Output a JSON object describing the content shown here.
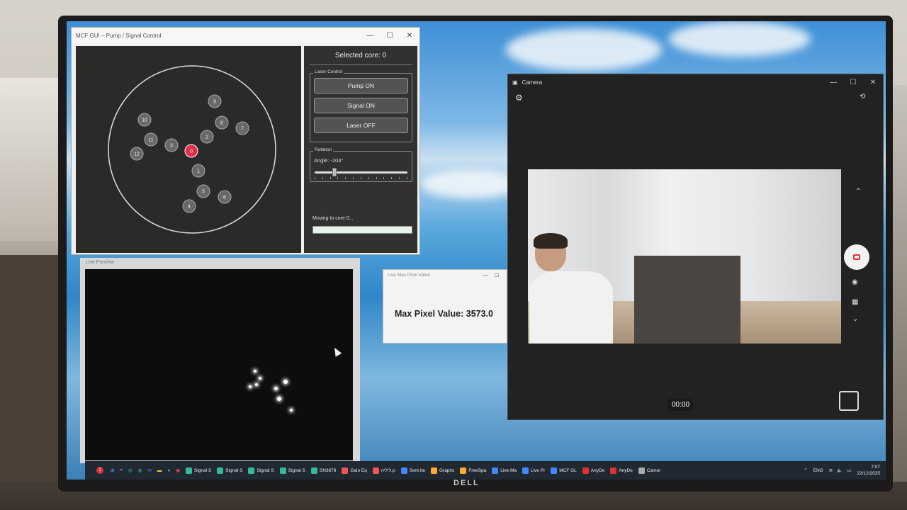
{
  "mcf_window": {
    "title": "MCF GUI – Pump / Signal Control",
    "selected_core": "Selected core: 0",
    "laser_group": "Laser Control",
    "pump_on": "Pump ON",
    "signal_on": "Signal ON",
    "laser_off": "Laser OFF",
    "rotation_group": "Rotation",
    "angle": "Angle: -104°",
    "rotation_angle_value": -104,
    "moving": "Moving to core 0...",
    "cores": [
      "0",
      "1",
      "2",
      "3",
      "4",
      "5",
      "6",
      "7",
      "8",
      "9",
      "10",
      "11",
      "12"
    ],
    "selected_color": "#e03050"
  },
  "live_preview": {
    "title": "Live Preview"
  },
  "max_pixel_window": {
    "title": "Live Max Pixel Value",
    "value_text": "Max Pixel Value: 3573.0"
  },
  "camera": {
    "title": "Camera",
    "timer": "00:00"
  },
  "taskbar": {
    "items": [
      "Signal S",
      "Signal S",
      "Signal S",
      "Signal S",
      "SN3878",
      "Gain Eq",
      "ליליה.p",
      "Sent Ite",
      "Graphs",
      "FreeSpa",
      "Live Ma",
      "Live Pr",
      "MCF GL",
      "AnyDe",
      "AnyDe",
      "Camer"
    ],
    "lang": "ENG",
    "time": "7:07",
    "date": "22/12/2025",
    "badge": "1"
  },
  "monitor": {
    "brand": "DELL"
  },
  "colors": {
    "accent_red": "#e03050",
    "taskbar": "#202832"
  }
}
